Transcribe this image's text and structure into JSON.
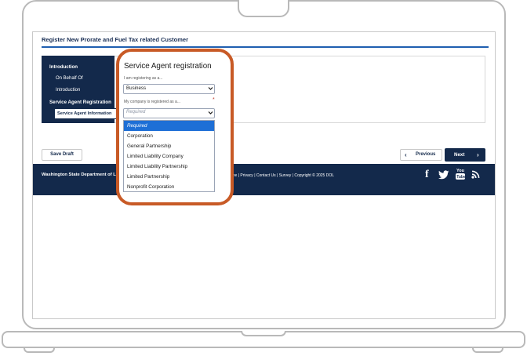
{
  "app": {
    "page_title": "Register New Prorate and Fuel Tax related Customer"
  },
  "sidebar": {
    "items": [
      {
        "label": "Introduction"
      },
      {
        "label": "On Behalf Of"
      },
      {
        "label": "Introduction"
      },
      {
        "label": "Service Agent Registration"
      },
      {
        "label": "Service Agent Information"
      }
    ]
  },
  "actions": {
    "save_draft": "Save Draft",
    "previous": "Previous",
    "next": "Next",
    "prev_icon": "‹",
    "next_icon": "›"
  },
  "footer": {
    "org": "Washington State Department of Licensing",
    "links": "Home | Privacy | Contact Us | Survey | Copyright © 2025 DOL",
    "social": {
      "facebook": "f",
      "twitter": "twitter",
      "youtube": "You Tube",
      "rss": "rss"
    }
  },
  "modal": {
    "title": "Service Agent registration",
    "registering_label": "I am registering as a...",
    "registering_value": "Business",
    "company_label": "My company is registered as a...",
    "required_mark": "*",
    "company_placeholder": "Required",
    "options": [
      "Required",
      "Corporation",
      "General Partnership",
      "Limited Liability Company",
      "Limited Liability Partnership",
      "Limited Partnership",
      "Nonprofit Corporation"
    ],
    "selected_index": 0
  },
  "colors": {
    "navy": "#13294b",
    "highlight": "#c85a26",
    "select_blue": "#1e6fd6"
  }
}
